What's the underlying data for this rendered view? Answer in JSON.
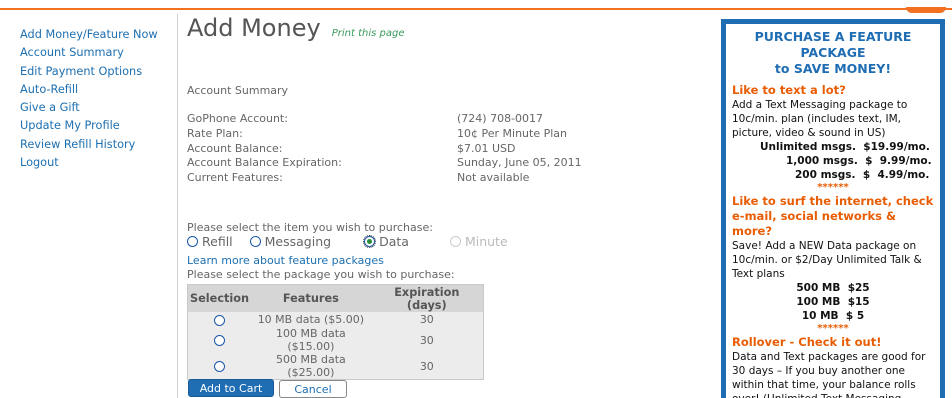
{
  "sidebar": {
    "items": [
      {
        "label": "Add Money/Feature Now"
      },
      {
        "label": "Account Summary"
      },
      {
        "label": "Edit Payment Options"
      },
      {
        "label": "Auto-Refill"
      },
      {
        "label": "Give a Gift"
      },
      {
        "label": "Update My Profile"
      },
      {
        "label": "Review Refill History"
      },
      {
        "label": "Logout"
      }
    ]
  },
  "main": {
    "title": "Add Money",
    "print_link": "Print this page",
    "account_summary_heading": "Account Summary",
    "account": [
      {
        "label": "GoPhone Account:",
        "value": "(724) 708-0017"
      },
      {
        "label": "Rate Plan:",
        "value": "10¢ Per Minute Plan"
      },
      {
        "label": "Account Balance:",
        "value": "$7.01  USD"
      },
      {
        "label": "Account Balance Expiration:",
        "value": "Sunday, June 05, 2011"
      },
      {
        "label": "Current Features:",
        "value": "Not available"
      }
    ],
    "select_item_prompt": "Please select the item you wish to purchase:",
    "purchase_options": [
      {
        "label": "Refill",
        "selected": false,
        "disabled": false
      },
      {
        "label": "Messaging",
        "selected": false,
        "disabled": false
      },
      {
        "label": "Data",
        "selected": true,
        "disabled": false
      },
      {
        "label": "Minute",
        "selected": false,
        "disabled": true
      }
    ],
    "learn_more_link": "Learn more about feature packages",
    "select_package_prompt": "Please select the package you wish to purchase:",
    "package_table": {
      "headers": [
        "Selection",
        "Features",
        "Expiration (days)"
      ],
      "rows": [
        {
          "feature": "10 MB data ($5.00)",
          "expiration": "30"
        },
        {
          "feature": "100 MB data ($15.00)",
          "expiration": "30"
        },
        {
          "feature": "500 MB data ($25.00)",
          "expiration": "30"
        }
      ]
    },
    "add_to_cart_label": "Add to Cart",
    "cancel_label": "Cancel"
  },
  "promo": {
    "heading_line1": "PURCHASE A FEATURE PACKAGE",
    "heading_line2": "to SAVE MONEY!",
    "text_heading": "Like to text a lot?",
    "text_body": "Add a Text Messaging package to 10c/min. plan (includes text, IM, picture, video & sound in US)",
    "text_prices": [
      "Unlimited msgs.  $19.99/mo.",
      "1,000 msgs.  $  9.99/mo.",
      "200 msgs.  $  4.99/mo."
    ],
    "stars": "******",
    "data_heading": "Like to surf the internet, check e-mail, social networks & more?",
    "data_body": "Save! Add a NEW Data package on 10c/min. or $2/Day Unlimited Talk & Text plans",
    "data_prices": [
      "500 MB  $25",
      "100 MB  $15",
      "10 MB  $ 5"
    ],
    "rollover_heading": "Rollover - Check it out!",
    "rollover_body": "Data and Text packages are good for 30 days – If you buy another one within that time, your balance rolls over! (Unlimited Text Messaging"
  },
  "colors": {
    "accent_orange": "#f37021",
    "link_blue": "#1d6fb0",
    "promo_border": "#1f6db3",
    "promo_heading_orange": "#e85d04"
  }
}
